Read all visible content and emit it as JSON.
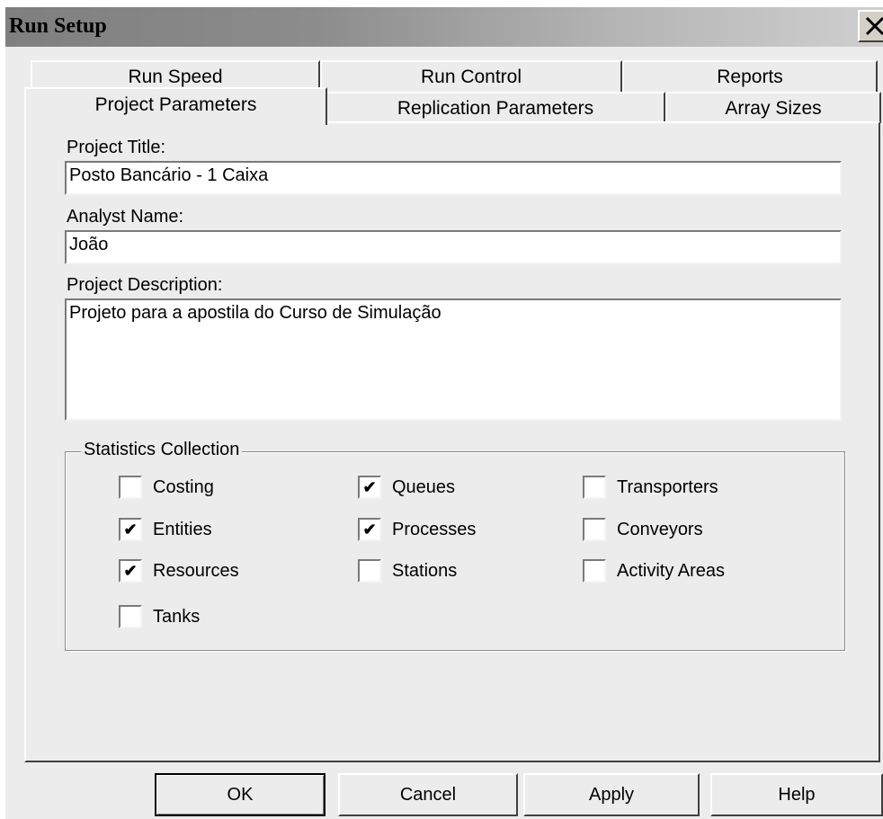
{
  "window": {
    "title": "Run Setup",
    "close_icon": "close-icon"
  },
  "tabs_row1": [
    {
      "label": "Run Speed"
    },
    {
      "label": "Run Control"
    },
    {
      "label": "Reports"
    }
  ],
  "tabs_row2": [
    {
      "label": "Project Parameters",
      "active": true
    },
    {
      "label": "Replication Parameters",
      "active": false
    },
    {
      "label": "Array Sizes",
      "active": false
    }
  ],
  "form": {
    "project_title_label": "Project Title:",
    "project_title_value": "Posto Bancário - 1 Caixa",
    "analyst_name_label": "Analyst Name:",
    "analyst_name_value": "João",
    "project_description_label": "Project Description:",
    "project_description_value": "Projeto para a apostila do Curso de Simulação"
  },
  "statistics": {
    "legend": "Statistics Collection",
    "items": [
      {
        "label": "Costing",
        "checked": false
      },
      {
        "label": "Queues",
        "checked": true
      },
      {
        "label": "Transporters",
        "checked": false
      },
      {
        "label": "Entities",
        "checked": true
      },
      {
        "label": "Processes",
        "checked": true
      },
      {
        "label": "Conveyors",
        "checked": false
      },
      {
        "label": "Resources",
        "checked": true
      },
      {
        "label": "Stations",
        "checked": false
      },
      {
        "label": "Activity Areas",
        "checked": false
      },
      {
        "label": "Tanks",
        "checked": false
      }
    ],
    "check_glyph": "✔"
  },
  "buttons": {
    "ok": "OK",
    "cancel": "Cancel",
    "apply": "Apply",
    "help": "Help"
  }
}
